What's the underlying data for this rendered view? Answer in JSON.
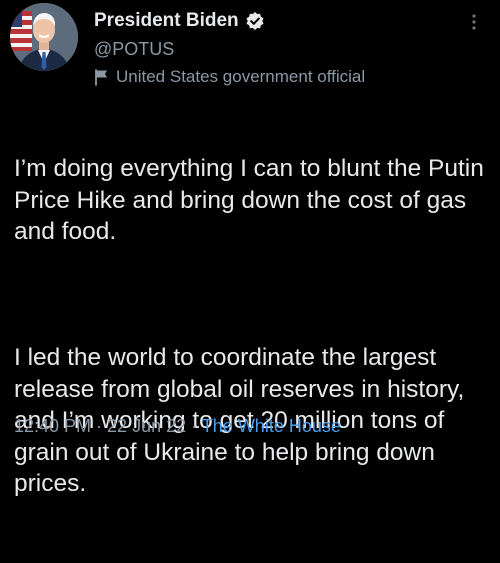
{
  "author": {
    "display_name": "President Biden",
    "handle": "@POTUS",
    "affiliation": "United States government official",
    "verified": true
  },
  "tweet": {
    "paragraphs": [
      "I’m doing everything I can to blunt the Putin Price Hike and bring down the cost of gas and food.",
      "I led the world to coordinate the largest release from global oil reserves in history, and I’m working to get 20 million tons of grain out of Ukraine to help bring down prices."
    ],
    "time": "12:40 PM",
    "date": "22 Jun 22",
    "source": "The White House",
    "separator": " · "
  },
  "icons": {
    "verified": "verified-badge-icon",
    "affiliation": "government-flag-icon",
    "more": "more-options-icon"
  },
  "colors": {
    "background": "#000000",
    "text": "#e7e9ea",
    "secondary": "#8b98a5",
    "link": "#4a9ff0"
  }
}
